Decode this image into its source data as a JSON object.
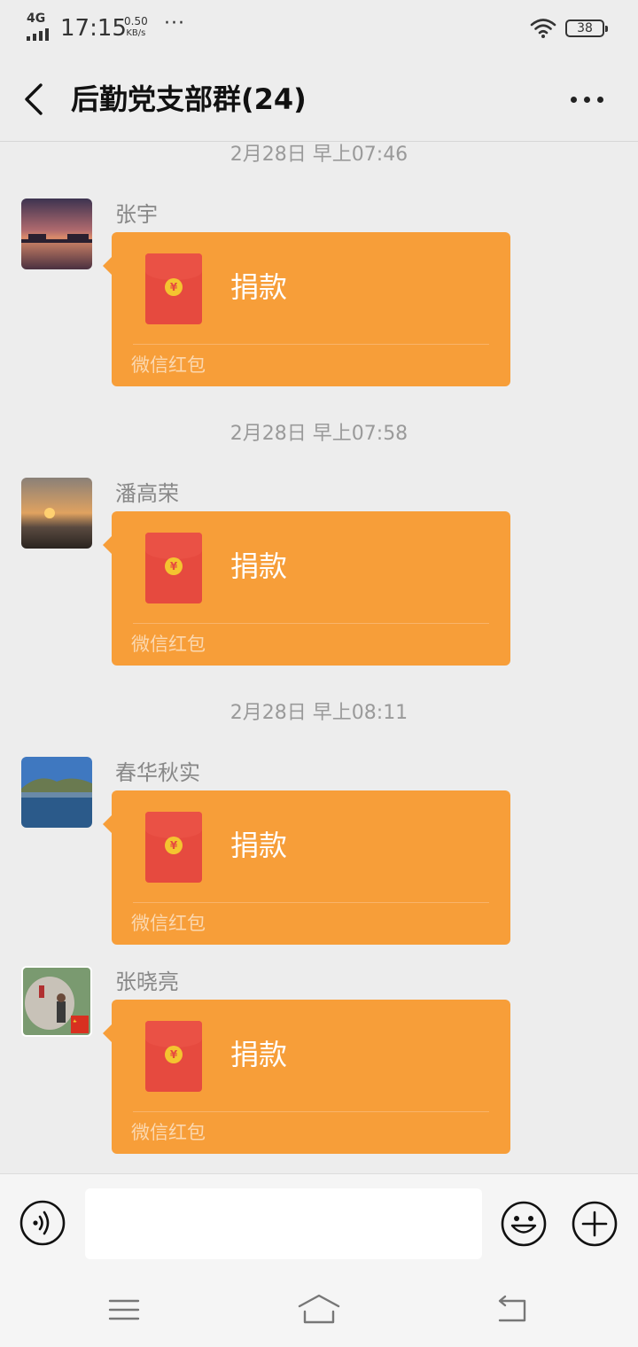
{
  "status_bar": {
    "network": "4G",
    "time": "17:15",
    "speed_value": "0.50",
    "speed_unit": "KB/s",
    "more": "···",
    "battery": "38"
  },
  "header": {
    "title": "后勤党支部群(24)"
  },
  "messages": [
    {
      "timestamp": "2月28日 早上07:46",
      "sender": "张宇",
      "packet_title": "捐款",
      "packet_footer": "微信红包",
      "avatar": "sunset-harbor"
    },
    {
      "timestamp": "2月28日 早上07:58",
      "sender": "潘高荣",
      "packet_title": "捐款",
      "packet_footer": "微信红包",
      "avatar": "sunrise-sea"
    },
    {
      "timestamp": "2月28日 早上08:11",
      "sender": "春华秋实",
      "packet_title": "捐款",
      "packet_footer": "微信红包",
      "avatar": "lake-mountain"
    },
    {
      "timestamp": "",
      "sender": "张晓亮",
      "packet_title": "捐款",
      "packet_footer": "微信红包",
      "avatar": "person-rock-flag"
    }
  ],
  "input": {
    "value": "",
    "placeholder": ""
  },
  "colors": {
    "background": "#ededed",
    "packet": "#f79e39",
    "envelope": "#e64a3f",
    "coin": "#f4c430"
  },
  "icons": {
    "back": "chevron-left-icon",
    "more": "more-dots-icon",
    "voice": "voice-icon",
    "emoji": "emoji-icon",
    "plus": "plus-icon",
    "nav_menu": "menu-icon",
    "nav_home": "home-icon",
    "nav_back": "back-icon"
  }
}
